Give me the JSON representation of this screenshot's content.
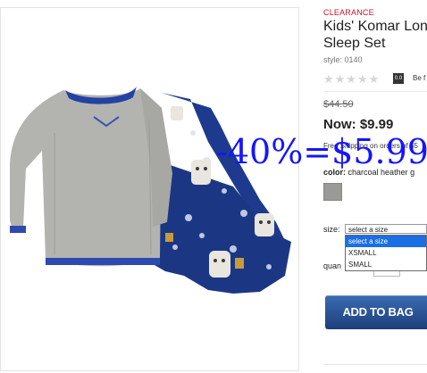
{
  "product": {
    "badge": "CLEARANCE",
    "title_line1": "Kids' Komar Lon",
    "title_line2": "Sleep Set",
    "style": "style: 0140",
    "stars": "★★★★★",
    "rating_value": "0.0",
    "rating_link": "Be f",
    "original_price": "$44.50",
    "now_price": "Now: $9.99",
    "shipping": "Free Shipping on orders of $5",
    "color_label": "color:",
    "color_value": "charcoal heather g",
    "size_label": "size:",
    "size_selected": "select a size",
    "size_options": [
      "select a size",
      "XSMALL",
      "SMALL"
    ],
    "quantity_label": "quan",
    "add_to_bag": "ADD TO BAG"
  },
  "overlay": {
    "promo_text": "-40%=$5.99"
  },
  "colors": {
    "accent_red": "#c8102e",
    "button_blue": "#2a4f94",
    "promo_blue": "#1515ff",
    "dropdown_highlight": "#1a6fe5"
  }
}
